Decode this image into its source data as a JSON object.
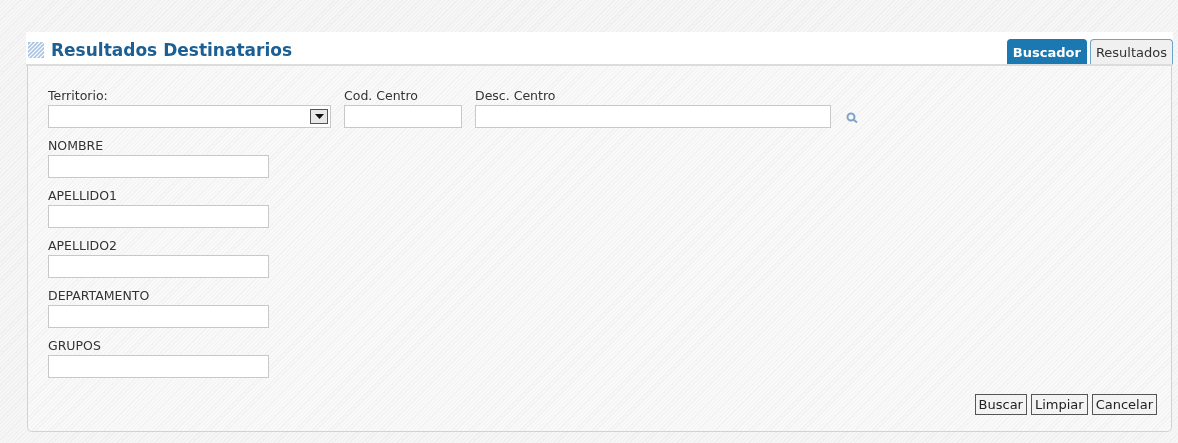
{
  "title": "Resultados Destinatarios",
  "tabs": [
    {
      "label": "Buscador",
      "selected": true
    },
    {
      "label": "Resultados",
      "selected": false
    }
  ],
  "top_fields": [
    {
      "kind": "select",
      "label": "Territorio:"
    },
    {
      "kind": "text",
      "label": "Cod. Centro"
    },
    {
      "kind": "text",
      "label": "Desc. Centro"
    }
  ],
  "fields": [
    {
      "label": "NOMBRE"
    },
    {
      "label": "APELLIDO1"
    },
    {
      "label": "APELLIDO2"
    },
    {
      "label": "DEPARTAMENTO"
    },
    {
      "label": "GRUPOS"
    }
  ],
  "buttons": [
    "Buscar",
    "Limpiar",
    "Cancelar"
  ]
}
